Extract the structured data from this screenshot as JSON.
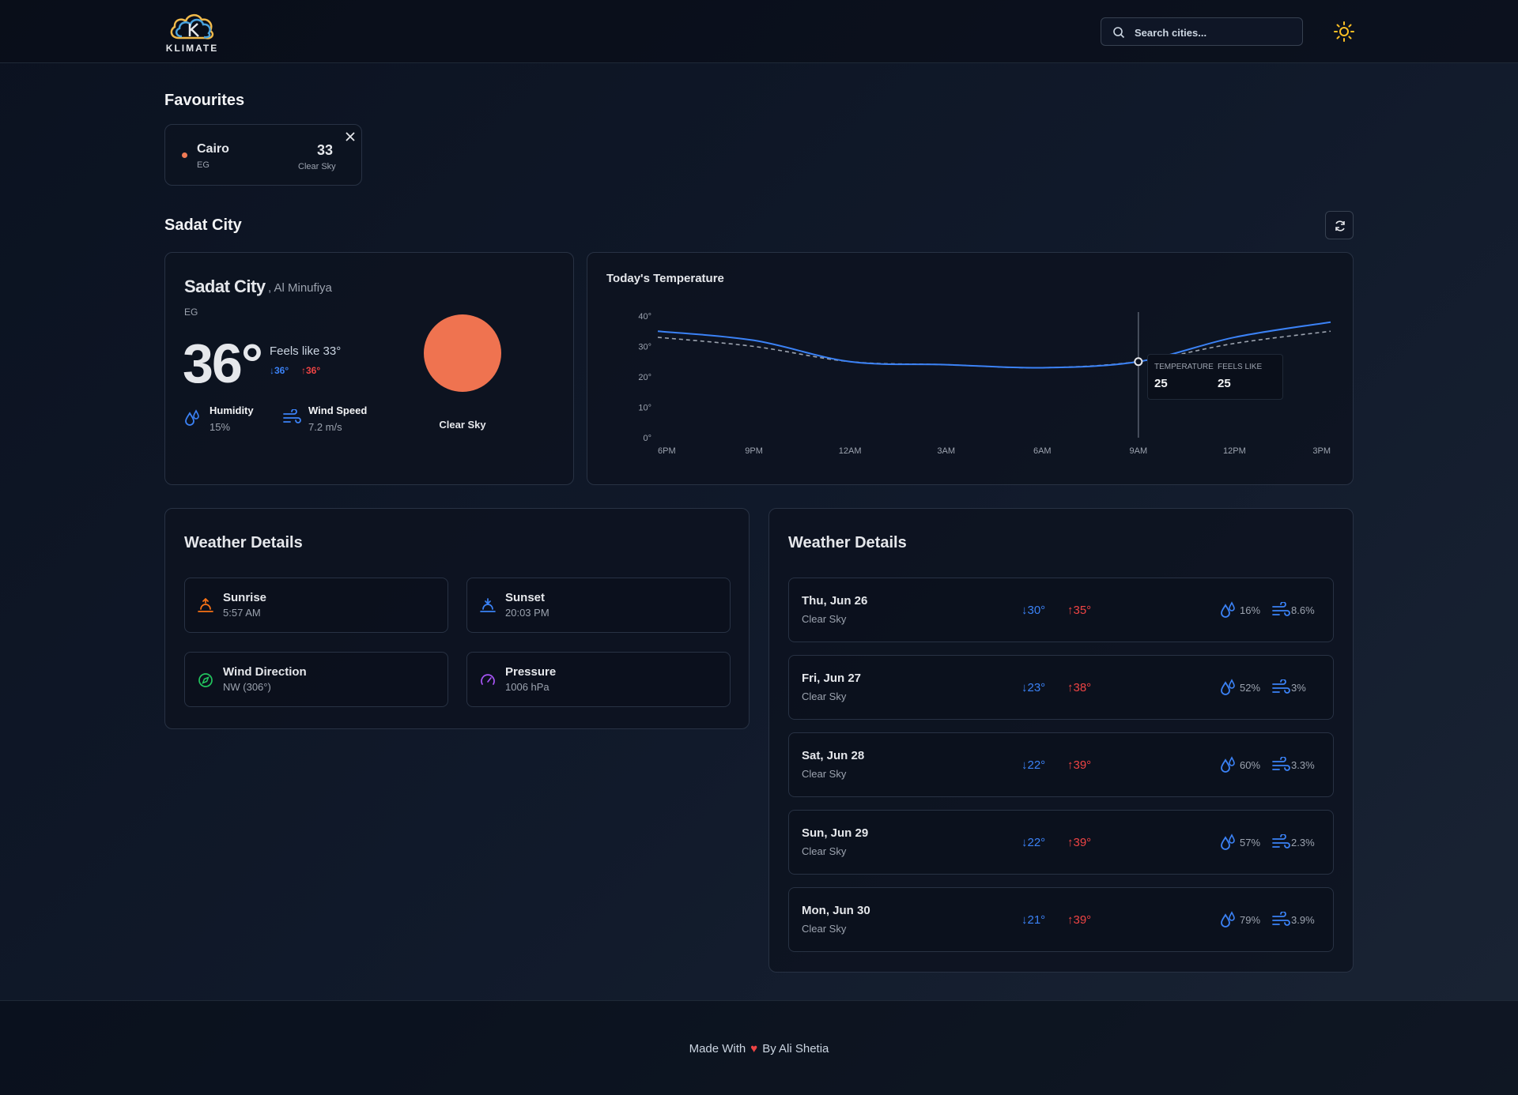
{
  "app": {
    "name": "KLIMATE"
  },
  "search": {
    "placeholder": "Search cities..."
  },
  "favourites": {
    "title": "Favourites",
    "items": [
      {
        "city": "Cairo",
        "country": "EG",
        "temp": "33",
        "condition": "Clear Sky"
      }
    ]
  },
  "location": {
    "heading": "Sadat City",
    "city": "Sadat City",
    "region": ", Al Minufiya",
    "country": "EG",
    "temp": "36°",
    "feels_like": "Feels like 33°",
    "min": "↓36°",
    "max": "↑36°",
    "humidity_label": "Humidity",
    "humidity": "15%",
    "wind_label": "Wind Speed",
    "wind": "7.2 m/s",
    "condition": "Clear Sky"
  },
  "chart": {
    "title": "Today's Temperature",
    "tooltip": {
      "temp_label": "TEMPERATURE",
      "temp": "25",
      "feels_label": "FEELS LIKE",
      "feels": "25"
    }
  },
  "chart_data": {
    "type": "line",
    "x": [
      "6PM",
      "9PM",
      "12AM",
      "3AM",
      "6AM",
      "9AM",
      "12PM",
      "3PM"
    ],
    "series": [
      {
        "name": "TEMPERATURE",
        "values": [
          35,
          32,
          25,
          24,
          23,
          25,
          33,
          38
        ]
      },
      {
        "name": "FEELS LIKE",
        "values": [
          33,
          30,
          25,
          24,
          23,
          25,
          31,
          35
        ]
      }
    ],
    "yticks": [
      "0°",
      "10°",
      "20°",
      "30°",
      "40°"
    ],
    "ylim": [
      0,
      40
    ],
    "grid": false,
    "highlight_x": "9AM"
  },
  "details": {
    "title": "Weather Details",
    "tiles": [
      {
        "label": "Sunrise",
        "value": "5:57 AM"
      },
      {
        "label": "Sunset",
        "value": "20:03 PM"
      },
      {
        "label": "Wind Direction",
        "value": "NW (306°)"
      },
      {
        "label": "Pressure",
        "value": "1006 hPa"
      }
    ]
  },
  "forecast": {
    "title": "Weather Details",
    "days": [
      {
        "date": "Thu, Jun 26",
        "condition": "Clear Sky",
        "min": "↓30°",
        "max": "↑35°",
        "humidity": "16%",
        "wind": "8.6%"
      },
      {
        "date": "Fri, Jun 27",
        "condition": "Clear Sky",
        "min": "↓23°",
        "max": "↑38°",
        "humidity": "52%",
        "wind": "3%"
      },
      {
        "date": "Sat, Jun 28",
        "condition": "Clear Sky",
        "min": "↓22°",
        "max": "↑39°",
        "humidity": "60%",
        "wind": "3.3%"
      },
      {
        "date": "Sun, Jun 29",
        "condition": "Clear Sky",
        "min": "↓22°",
        "max": "↑39°",
        "humidity": "57%",
        "wind": "2.3%"
      },
      {
        "date": "Mon, Jun 30",
        "condition": "Clear Sky",
        "min": "↓21°",
        "max": "↑39°",
        "humidity": "79%",
        "wind": "3.9%"
      }
    ]
  },
  "footer": {
    "made_with": "Made With",
    "by": "By Ali Shetia"
  },
  "colors": {
    "accent": "#3b82f6",
    "hot": "#ef4444",
    "sun": "#ef7350",
    "theme_icon": "#fbbf24"
  }
}
